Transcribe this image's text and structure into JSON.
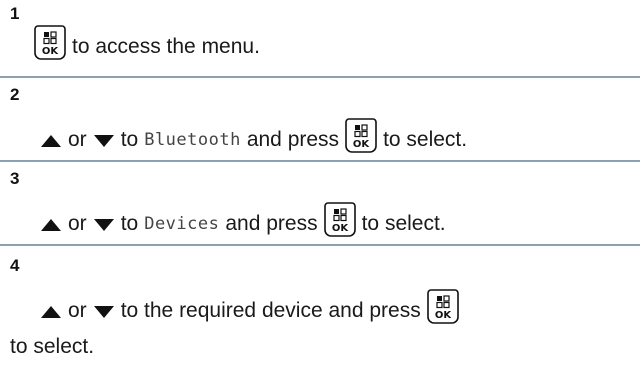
{
  "steps": [
    {
      "number": "1",
      "key_icon": "ok-menu-key-icon",
      "text": "to access the menu."
    },
    {
      "number": "2",
      "up_icon": "up-arrow-icon",
      "or_text": "or",
      "down_icon": "down-arrow-icon",
      "to_text": "to",
      "menu_item": "Bluetooth",
      "press_text": "and press",
      "key_icon": "ok-menu-key-icon",
      "select_text": "to select."
    },
    {
      "number": "3",
      "up_icon": "up-arrow-icon",
      "or_text": "or",
      "down_icon": "down-arrow-icon",
      "to_text": "to",
      "menu_item": "Devices",
      "press_text": "and press",
      "key_icon": "ok-menu-key-icon",
      "select_text": "to select."
    },
    {
      "number": "4",
      "up_icon": "up-arrow-icon",
      "or_text": "or",
      "down_icon": "down-arrow-icon",
      "line1_text": "to the required device and press",
      "key_icon": "ok-menu-key-icon",
      "line2_text": "to select."
    }
  ],
  "colors": {
    "separator": "#8ba1b0",
    "text": "#1a1a1a"
  }
}
